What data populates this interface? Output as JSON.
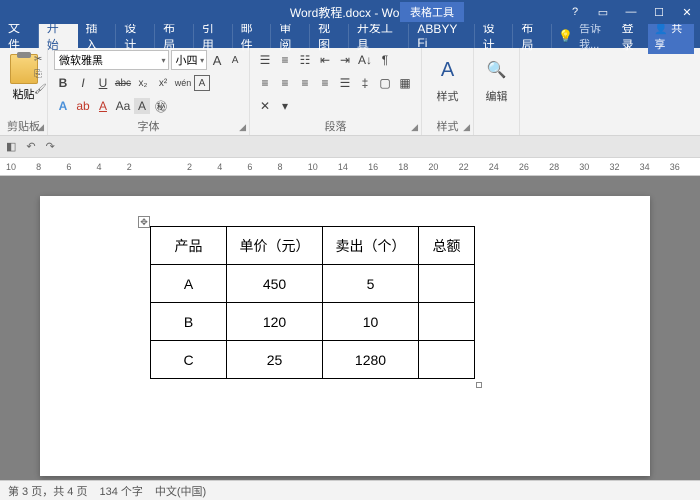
{
  "titlebar": {
    "title": "Word教程.docx - Word",
    "context": "表格工具"
  },
  "tabs": {
    "items": [
      "文件",
      "开始",
      "插入",
      "设计",
      "布局",
      "引用",
      "邮件",
      "审阅",
      "视图",
      "开发工具",
      "ABBYY Fi",
      "设计",
      "布局"
    ],
    "activeIndex": 1,
    "tellme": "告诉我...",
    "login": "登录",
    "share": "共享"
  },
  "ribbon": {
    "clipboard": {
      "paste": "粘贴",
      "label": "剪贴板"
    },
    "font": {
      "name": "微软雅黑",
      "size": "小四",
      "bold": "B",
      "italic": "I",
      "underline": "U",
      "strike": "abc",
      "sub": "x₂",
      "sup": "x²",
      "phonetic": "wén",
      "charborder": "A",
      "grow": "A",
      "shrink": "A",
      "clear": "Aa",
      "highlight": "ab",
      "fontcolor": "A",
      "label": "字体"
    },
    "paragraph": {
      "label": "段落"
    },
    "styles": {
      "btn": "样式",
      "label": "样式"
    },
    "editing": {
      "btn": "编辑"
    }
  },
  "ruler": [
    "10",
    "",
    "8",
    "",
    "6",
    "",
    "4",
    "",
    "2",
    "",
    "",
    "2",
    "",
    "4",
    "#",
    "6",
    "",
    "8",
    "",
    "10",
    "",
    "#",
    "",
    "14",
    "",
    "16",
    "",
    "18",
    "#",
    "20",
    "",
    "22",
    "#",
    "24",
    "",
    "26",
    "",
    "28",
    "",
    "30",
    "",
    "32",
    "",
    "34",
    "",
    "36"
  ],
  "table": {
    "headers": [
      "产品",
      "单价（元）",
      "卖出（个）",
      "总额"
    ],
    "rows": [
      [
        "A",
        "450",
        "5",
        ""
      ],
      [
        "B",
        "120",
        "10",
        ""
      ],
      [
        "C",
        "25",
        "1280",
        ""
      ]
    ]
  },
  "statusbar": {
    "page": "第 3 页，共 4 页",
    "words": "134 个字",
    "lang": "中文(中国)"
  }
}
